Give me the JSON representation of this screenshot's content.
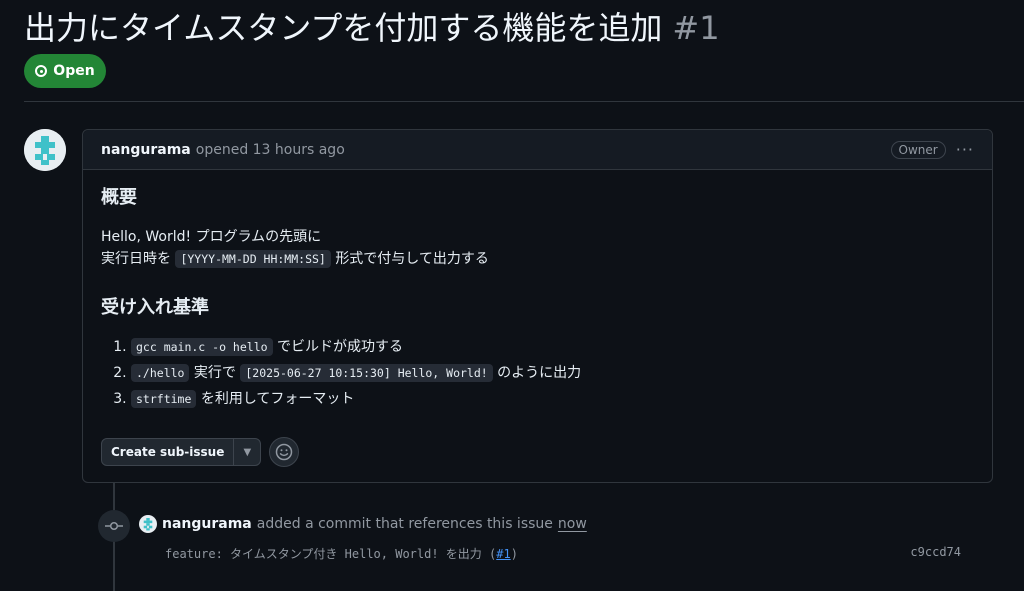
{
  "issue": {
    "title": "出力にタイムスタンプを付加する機能を追加",
    "number": "#1",
    "state": "Open"
  },
  "comment": {
    "author": "nangurama",
    "action": "opened 13 hours ago",
    "role_badge": "Owner",
    "menu": "···",
    "heading1": "概要",
    "line1": "Hello, World! プログラムの先頭に",
    "line2_pre": "実行日時を",
    "line2_code": "[YYYY-MM-DD HH:MM:SS]",
    "line2_post": "形式で付与して出力する",
    "heading2": "受け入れ基準",
    "criteria": [
      {
        "code": "gcc main.c -o hello",
        "text": "でビルドが成功する"
      },
      {
        "code": "./hello",
        "text": "実行で",
        "code2": "[2025-06-27 10:15:30] Hello, World!",
        "text2": "のように出力"
      },
      {
        "code": "strftime",
        "text": "を利用してフォーマット"
      }
    ],
    "sub_issue_button": "Create sub-issue"
  },
  "timeline": {
    "author": "nangurama",
    "action": "added a commit that references this issue",
    "when": "now",
    "commit_message_pre": "feature: タイムスタンプ付き Hello, World! を出力 (",
    "commit_ref": "#1",
    "commit_message_post": ")",
    "commit_sha": "c9ccd74"
  },
  "colors": {
    "background": "#0d1117",
    "open_green": "#238636",
    "link_blue": "#4493f8",
    "avatar_teal": "#3fc1c9"
  }
}
